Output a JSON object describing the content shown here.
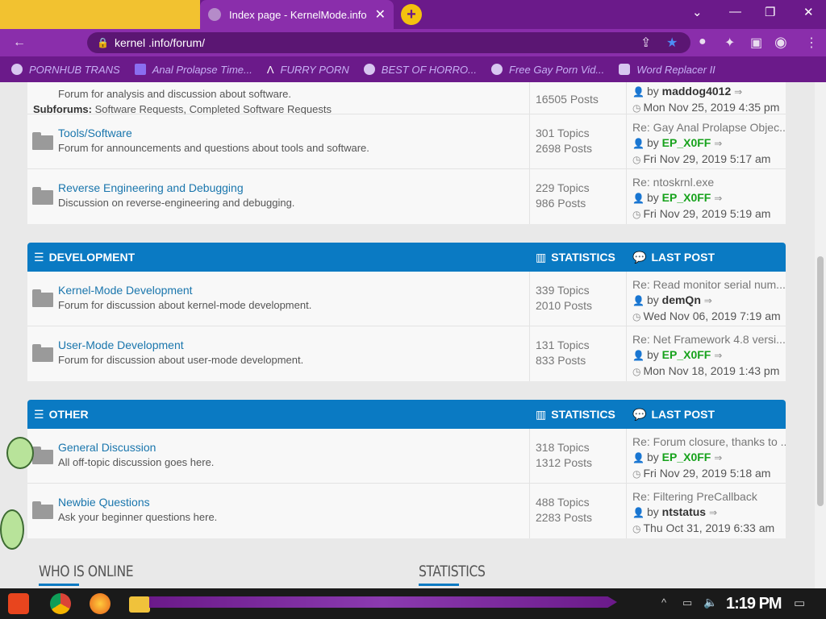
{
  "browser": {
    "active_tab_title": "Index page - KernelMode.info",
    "tab_close": "✕",
    "new_tab": "+",
    "url": "kernel      .info/forum/",
    "window_controls": [
      "⌄",
      "—",
      "❐",
      "✕"
    ]
  },
  "bookmarks": [
    {
      "label": "PORNHUB TRANS",
      "icon": "globe-icon"
    },
    {
      "label": "Anal Prolapse Time...",
      "icon": "bookmark-icon"
    },
    {
      "label": "FURRY PORN",
      "icon": "logo-icon"
    },
    {
      "label": "BEST OF HORRO...",
      "icon": "globe-icon"
    },
    {
      "label": "Free Gay Porn Vid...",
      "icon": "site-icon"
    },
    {
      "label": "Word Replacer II",
      "icon": "extension-icon"
    }
  ],
  "top_partial": {
    "desc": "Forum for analysis and discussion about software.",
    "subforums_label": "Subforums:",
    "subforums": "Software Requests, Completed Software Requests",
    "posts": "16505 Posts",
    "last_by_prefix": "by",
    "last_user": "maddog4012",
    "last_date": "Mon Nov 25, 2019 4:35 pm"
  },
  "blocks": [
    {
      "rows": [
        {
          "name": "Tools/Software",
          "desc": "Forum for announcements and questions about tools and software.",
          "topics": "301 Topics",
          "posts": "2698 Posts",
          "last_title": "Re: Gay Anal Prolapse Objec...",
          "last_user": "EP_X0FF",
          "user_green": true,
          "last_date": "Fri Nov 29, 2019 5:17 am"
        },
        {
          "name": "Reverse Engineering and Debugging",
          "desc": "Discussion on reverse-engineering and debugging.",
          "topics": "229 Topics",
          "posts": "986 Posts",
          "last_title": "Re: ntoskrnl.exe",
          "last_user": "EP_X0FF",
          "user_green": true,
          "last_date": "Fri Nov 29, 2019 5:19 am"
        }
      ]
    },
    {
      "title": "DEVELOPMENT",
      "stats_label": "STATISTICS",
      "last_label": "LAST POST",
      "rows": [
        {
          "name": "Kernel-Mode Development",
          "desc": "Forum for discussion about kernel-mode development.",
          "topics": "339 Topics",
          "posts": "2010 Posts",
          "last_title": "Re: Read monitor serial num...",
          "last_user": "demQn",
          "user_green": false,
          "last_date": "Wed Nov 06, 2019 7:19 am"
        },
        {
          "name": "User-Mode Development",
          "desc": "Forum for discussion about user-mode development.",
          "topics": "131 Topics",
          "posts": "833 Posts",
          "last_title": "Re: Net Framework 4.8 versi...",
          "last_user": "EP_X0FF",
          "user_green": true,
          "last_date": "Mon Nov 18, 2019 1:43 pm"
        }
      ]
    },
    {
      "title": "OTHER",
      "stats_label": "STATISTICS",
      "last_label": "LAST POST",
      "rows": [
        {
          "name": "General Discussion",
          "desc": "All off-topic discussion goes here.",
          "topics": "318 Topics",
          "posts": "1312 Posts",
          "last_title": "Re: Forum closure, thanks to ...",
          "last_user": "EP_X0FF",
          "user_green": true,
          "last_date": "Fri Nov 29, 2019 5:18 am"
        },
        {
          "name": "Newbie Questions",
          "desc": "Ask your beginner questions here.",
          "topics": "488 Topics",
          "posts": "2283 Posts",
          "last_title": "Re: Filtering PreCallback",
          "last_user": "ntstatus",
          "user_green": false,
          "last_date": "Thu Oct 31, 2019 6:33 am"
        }
      ]
    }
  ],
  "by_prefix": "by",
  "sections": {
    "who_is_online": "WHO IS ONLINE",
    "statistics": "STATISTICS"
  },
  "taskbar": {
    "clock": "1:19 PM"
  },
  "colors": {
    "header_blue": "#0a7ac3",
    "link_blue": "#1a76ad",
    "user_green": "#16a21b",
    "browser_purple": "#8a2eab",
    "tab_yellow": "#f2c230"
  }
}
